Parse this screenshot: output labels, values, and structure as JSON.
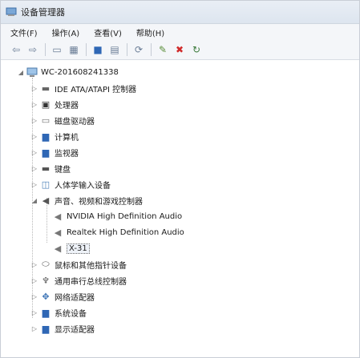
{
  "window": {
    "title": "设备管理器"
  },
  "menu": [
    "文件(F)",
    "操作(A)",
    "查看(V)",
    "帮助(H)"
  ],
  "toolbar_icons": [
    "back-icon",
    "forward-icon",
    "properties-icon",
    "help-grid-icon",
    "monitor-icon",
    "list-icon",
    "scan-icon",
    "update-driver-icon",
    "disable-icon",
    "uninstall-icon"
  ],
  "tree": {
    "root": "WC-201608241338",
    "categories": [
      {
        "label": "IDE ATA/ATAPI 控制器",
        "icon": "ide-controller-icon"
      },
      {
        "label": "处理器",
        "icon": "processor-icon"
      },
      {
        "label": "磁盘驱动器",
        "icon": "disk-drive-icon"
      },
      {
        "label": "计算机",
        "icon": "computer-icon"
      },
      {
        "label": "监视器",
        "icon": "monitor-icon"
      },
      {
        "label": "键盘",
        "icon": "keyboard-icon"
      },
      {
        "label": "人体学输入设备",
        "icon": "hid-icon"
      },
      {
        "label": "声音、视频和游戏控制器",
        "icon": "sound-icon",
        "expanded": true,
        "children": [
          {
            "label": "NVIDIA High Definition Audio",
            "icon": "speaker-icon"
          },
          {
            "label": "Realtek High Definition Audio",
            "icon": "speaker-icon"
          },
          {
            "label": "X-31",
            "icon": "speaker-icon",
            "selected": true
          }
        ]
      },
      {
        "label": "鼠标和其他指针设备",
        "icon": "mouse-icon"
      },
      {
        "label": "通用串行总线控制器",
        "icon": "usb-icon"
      },
      {
        "label": "网络适配器",
        "icon": "network-icon"
      },
      {
        "label": "系统设备",
        "icon": "system-device-icon"
      },
      {
        "label": "显示适配器",
        "icon": "display-adapter-icon"
      }
    ]
  }
}
